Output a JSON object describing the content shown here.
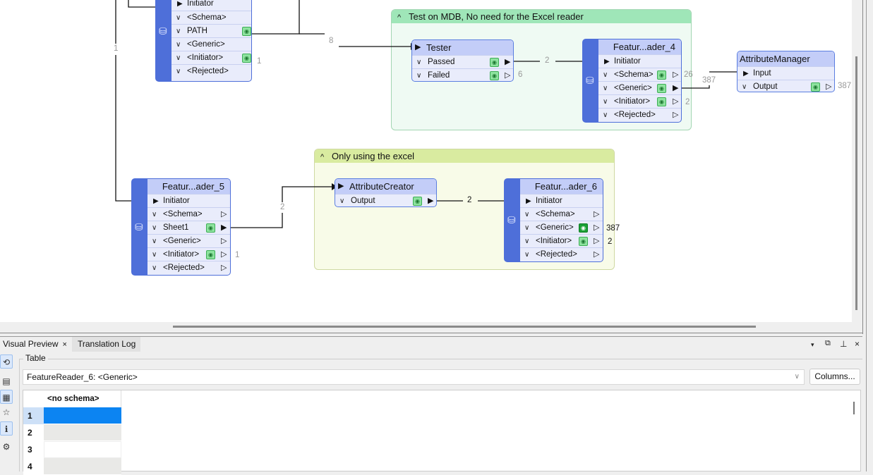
{
  "canvas": {
    "bookmarks": [
      {
        "id": "bm-mdb",
        "title": "Test on MDB, No need for the Excel reader",
        "color": "#9fe6b8",
        "collapse_icon": "caret-up-icon"
      },
      {
        "id": "bm-excel",
        "title": "Only using the excel",
        "color": "#d9eba0",
        "collapse_icon": "caret-up-icon"
      }
    ],
    "reader_top": {
      "initiator_label": "Initiator",
      "ports": [
        "<Schema>",
        "PATH",
        "<Generic>",
        "<Initiator>",
        "<Rejected>"
      ],
      "initiator_count": "1"
    },
    "tester": {
      "title": "Tester",
      "ports": [
        "Passed",
        "Failed"
      ],
      "failed_count": "6"
    },
    "reader_4": {
      "title": "Featur...ader_4",
      "initiator_label": "Initiator",
      "ports": [
        "<Schema>",
        "<Generic>",
        "<Initiator>",
        "<Rejected>"
      ],
      "schema_count": "26",
      "initiator_count": "2"
    },
    "attribute_manager": {
      "title": "AttributeManager",
      "input_label": "Input",
      "output_label": "Output",
      "output_count": "387"
    },
    "reader_5": {
      "title": "Featur...ader_5",
      "initiator_label": "Initiator",
      "ports": [
        "<Schema>",
        "Sheet1",
        "<Generic>",
        "<Initiator>",
        "<Rejected>"
      ],
      "initiator_count": "1"
    },
    "attribute_creator": {
      "title": "AttributeCreator",
      "output_label": "Output"
    },
    "reader_6": {
      "title": "Featur...ader_6",
      "initiator_label": "Initiator",
      "ports": [
        "<Schema>",
        "<Generic>",
        "<Initiator>",
        "<Rejected>"
      ],
      "generic_count": "387",
      "initiator_count": "2"
    },
    "connection_counts": {
      "left_vertical": "1",
      "path_to_tester": "8",
      "passed_to_reader4": "2",
      "reader4_to_attrmgr": "387",
      "sheet1_to_creator": "2",
      "creator_to_reader6": "2"
    }
  },
  "panel": {
    "tabs": [
      {
        "label": "Visual Preview",
        "close": "×",
        "active": true
      },
      {
        "label": "Translation Log",
        "active": false
      }
    ],
    "window_controls": {
      "menu": "▾",
      "float": "🗗",
      "pin": "⚲",
      "close": "×"
    },
    "group_label": "Table",
    "selected_source": "FeatureReader_6: <Generic>",
    "columns_button": "Columns...",
    "table": {
      "columns": [
        "<no schema>"
      ],
      "rows": [
        {
          "index": "1",
          "selected": true
        },
        {
          "index": "2",
          "selected": false
        },
        {
          "index": "3",
          "selected": false
        },
        {
          "index": "4",
          "selected": false
        }
      ]
    },
    "left_tools": [
      "select-tool-icon",
      "table-view-icon",
      "grid-view-icon",
      "shape-tool-icon",
      "info-icon",
      "settings-icon"
    ]
  }
}
